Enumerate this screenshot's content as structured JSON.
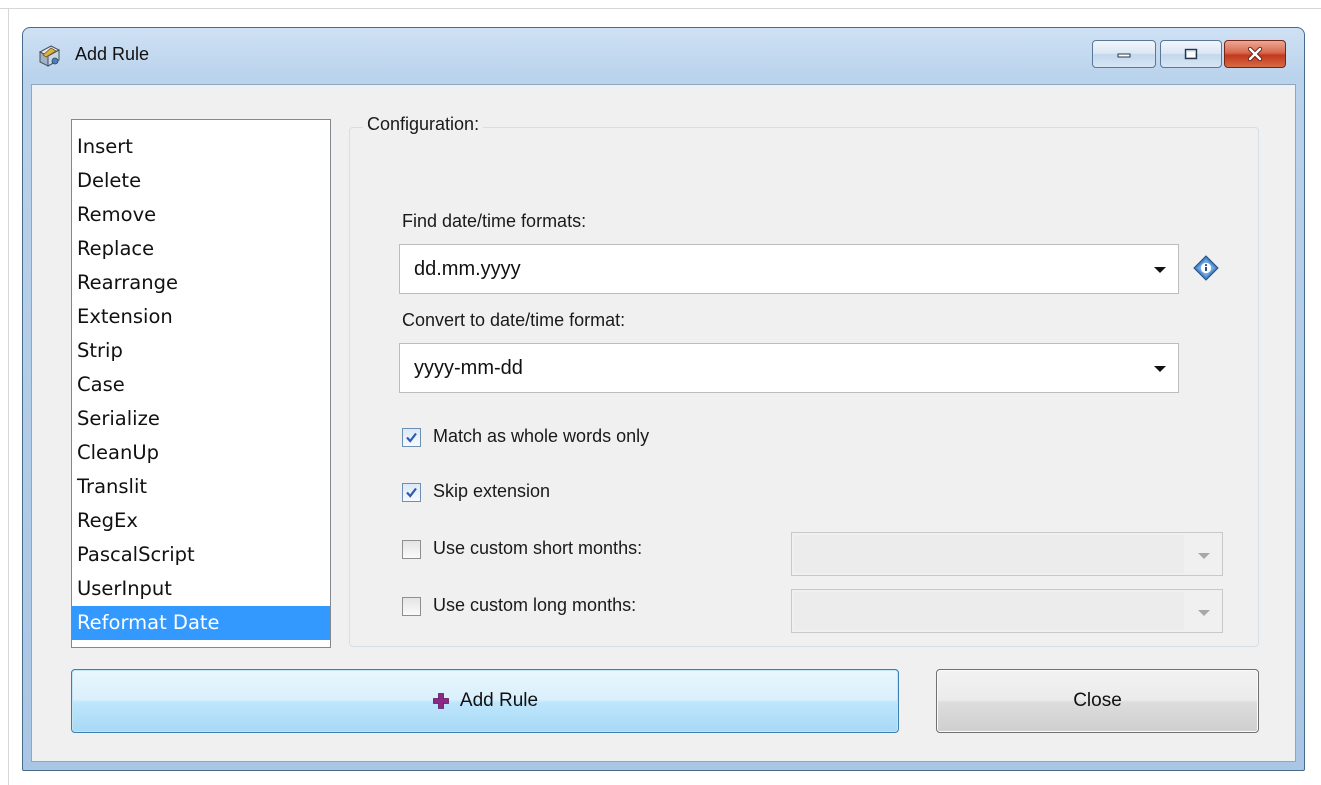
{
  "window": {
    "title": "Add Rule"
  },
  "rules": {
    "items": [
      {
        "label": "Insert"
      },
      {
        "label": "Delete"
      },
      {
        "label": "Remove"
      },
      {
        "label": "Replace"
      },
      {
        "label": "Rearrange"
      },
      {
        "label": "Extension"
      },
      {
        "label": "Strip"
      },
      {
        "label": "Case"
      },
      {
        "label": "Serialize"
      },
      {
        "label": "CleanUp"
      },
      {
        "label": "Translit"
      },
      {
        "label": "RegEx"
      },
      {
        "label": "PascalScript"
      },
      {
        "label": "UserInput"
      },
      {
        "label": "Reformat Date"
      }
    ],
    "selected": "Reformat Date"
  },
  "config": {
    "legend": "Configuration:",
    "find_label": "Find date/time formats:",
    "find_value": "dd.mm.yyyy",
    "convert_label": "Convert to date/time format:",
    "convert_value": "yyyy-mm-dd",
    "whole_words_label": "Match as whole words only",
    "whole_words_checked": true,
    "skip_ext_label": "Skip extension",
    "skip_ext_checked": true,
    "short_months_label": "Use custom short months:",
    "short_months_checked": false,
    "short_months_value": "",
    "long_months_label": "Use custom long months:",
    "long_months_checked": false,
    "long_months_value": ""
  },
  "buttons": {
    "add_rule": "Add Rule",
    "close": "Close"
  },
  "icons": {
    "app": "rule-wizard-icon",
    "info": "info-diamond-icon",
    "add": "plus-icon"
  },
  "colors": {
    "selection": "#3399ff",
    "add_button_border": "#3c7fb1",
    "close_caption": "#c2391d"
  }
}
